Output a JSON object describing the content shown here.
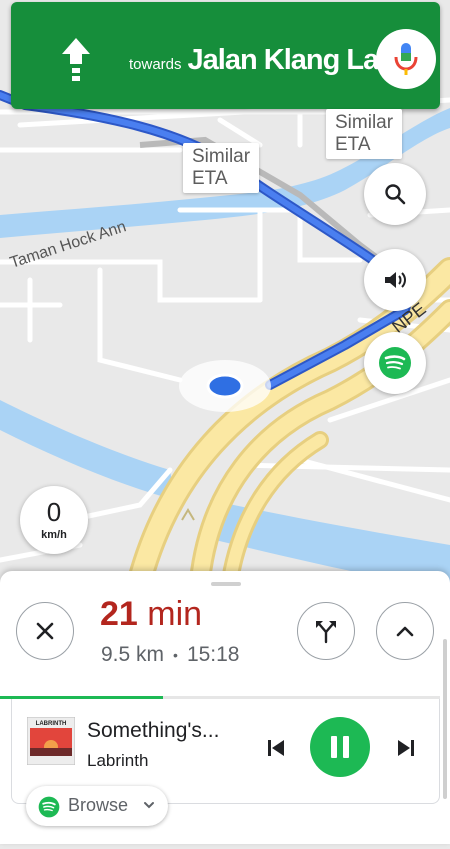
{
  "navigation": {
    "towards_label": "towards",
    "street": "Jalan Klang Lama",
    "maneuver_icon": "straight-arrow-icon"
  },
  "map": {
    "place_label": "Taman Hock Ann",
    "road_label": "NPE",
    "alternates": [
      {
        "line1": "Similar",
        "line2": "ETA"
      },
      {
        "line1": "Similar",
        "line2": "ETA"
      }
    ]
  },
  "speedometer": {
    "value": "0",
    "unit": "km/h"
  },
  "trip": {
    "duration_number": "21",
    "duration_unit": "min",
    "distance": "9.5 km",
    "separator": "•",
    "arrival_time": "15:18"
  },
  "media": {
    "progress_fraction": 0.37,
    "title": "Something's...",
    "artist": "Labrinth",
    "album_art_text": "LABRINTH",
    "browse_label": "Browse"
  },
  "colors": {
    "banner": "#168e3b",
    "route": "#4a7ff0",
    "eta_red": "#b3261e",
    "spotify": "#1db954"
  }
}
